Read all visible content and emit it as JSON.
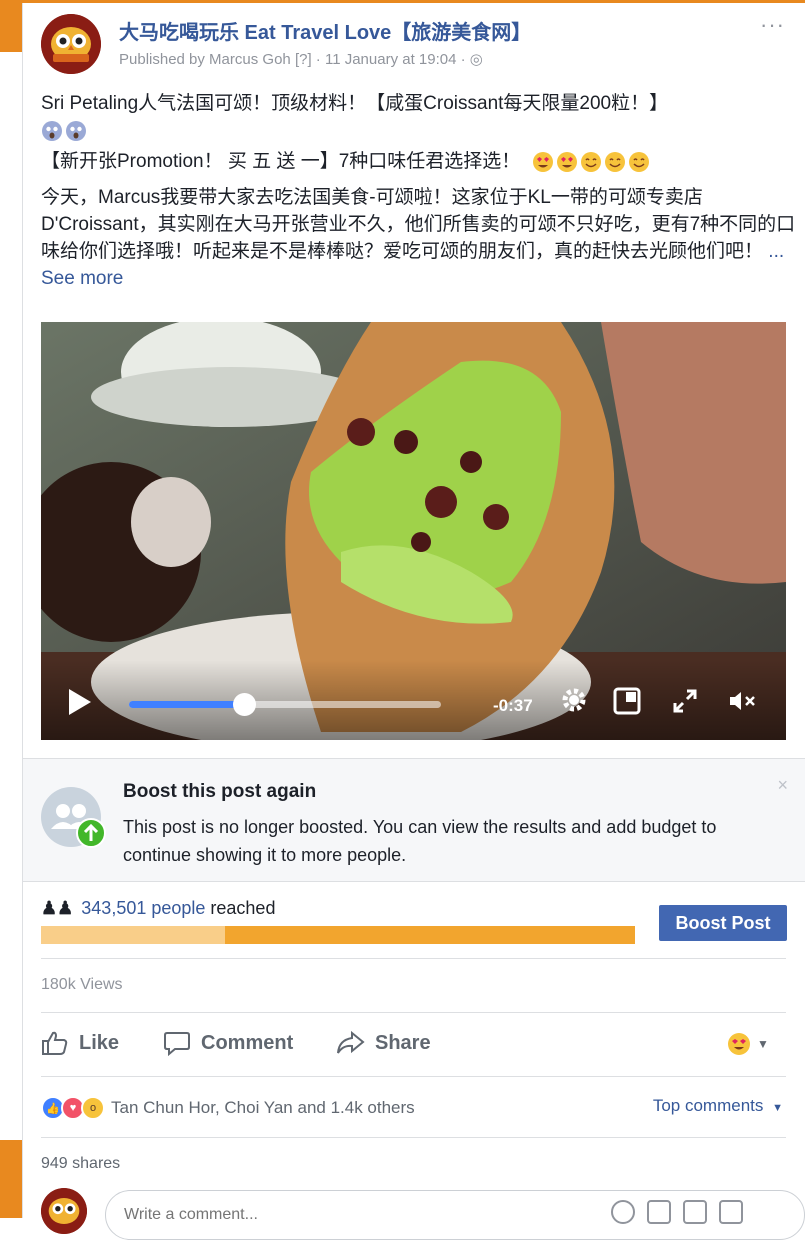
{
  "post": {
    "page_name": "大马吃喝玩乐 Eat Travel Love【旅游美食网】",
    "published_by": "Published by Marcus Goh",
    "info_marker": "[?]",
    "date": "11 January at 19:04",
    "more_label": "···",
    "line1": "Sri Petaling人气法国可颂！顶级材料！【咸蛋Croissant每天限量200粒！】",
    "line3": "【新开张Promotion！ 买 五 送 一】7种口味任君选择选！",
    "paragraph": "今天，Marcus我要带大家去吃法国美食-可颂啦！这家位于KL一带的可颂专卖店D'Croissant，其实刚在大马开张营业不久，他们所售卖的可颂不只好吃，更有7种不同的口味给你们选择哦！听起来是不是棒棒哒？爱吃可颂的朋友们，真的赶快去光顾他们吧！",
    "see_more": "... See more"
  },
  "video": {
    "time_remaining": "-0:37",
    "progress_fraction": 0.37
  },
  "boost": {
    "title": "Boost this post again",
    "description": "This post is no longer boosted. You can view the results and add budget to continue showing it to more people.",
    "close": "×"
  },
  "reach": {
    "count": "343,501 people",
    "suffix": " reached",
    "paid_fraction": 0.31,
    "button": "Boost Post"
  },
  "views": "180k Views",
  "actions": {
    "like": "Like",
    "comment": "Comment",
    "share": "Share"
  },
  "reactions": {
    "names": "Tan Chun Hor, Choi Yan and 1.4k others",
    "top_comments": "Top comments"
  },
  "shares": "949 shares",
  "comment_box": {
    "placeholder": "Write a comment..."
  },
  "colors": {
    "brand_link": "#365899",
    "boost_button": "#4267b2",
    "orange": "#e8891f"
  }
}
